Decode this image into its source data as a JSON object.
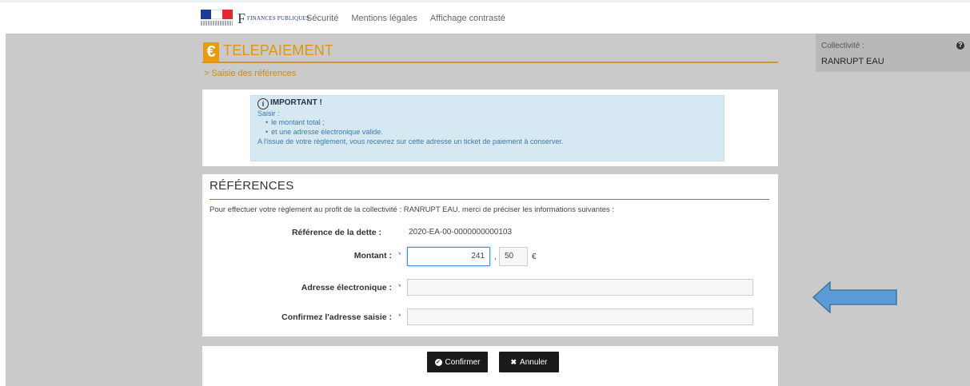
{
  "header": {
    "logo_rf_name": "republique-francaise-logo",
    "logo_fp_text": "FINANCES PUBLIQUES",
    "links": [
      "Sécurité",
      "Mentions légales",
      "Affichage contrasté"
    ]
  },
  "page": {
    "title": "TELEPAIEMENT",
    "euro_symbol": "€",
    "breadcrumb": "Saisie des références"
  },
  "collectivite": {
    "label": "Collectivité :",
    "value": "RANRUPT EAU",
    "help": "?"
  },
  "important": {
    "title": "IMPORTANT !",
    "intro": "Saisir :",
    "items": [
      "le montant total ;",
      "et une adresse électronique valide."
    ],
    "footer": "A l'issue de votre règlement, vous recevrez sur cette adresse un ticket de paiement à conserver."
  },
  "references": {
    "title": "RÉFÉRENCES",
    "intro": "Pour effectuer votre règlement au profit de la collectivité : RANRUPT EAU, merci de préciser les informations suivantes :",
    "dette_label": "Référence de la dette :",
    "dette_value": "2020-EA-00-0000000000103",
    "montant_label": "Montant :",
    "montant_euros": "241",
    "montant_cents": "50",
    "currency": "€",
    "required": "*",
    "email_label": "Adresse électronique :",
    "email_value": "",
    "confirm_label": "Confirmez l'adresse saisie :",
    "confirm_value": ""
  },
  "actions": {
    "confirm_label": "Confirmer",
    "cancel_label": "Annuler"
  },
  "colors": {
    "accent_orange": "#e0960e",
    "info_bg": "#d6e9f3",
    "arrow_blue": "#5b9bd5"
  }
}
